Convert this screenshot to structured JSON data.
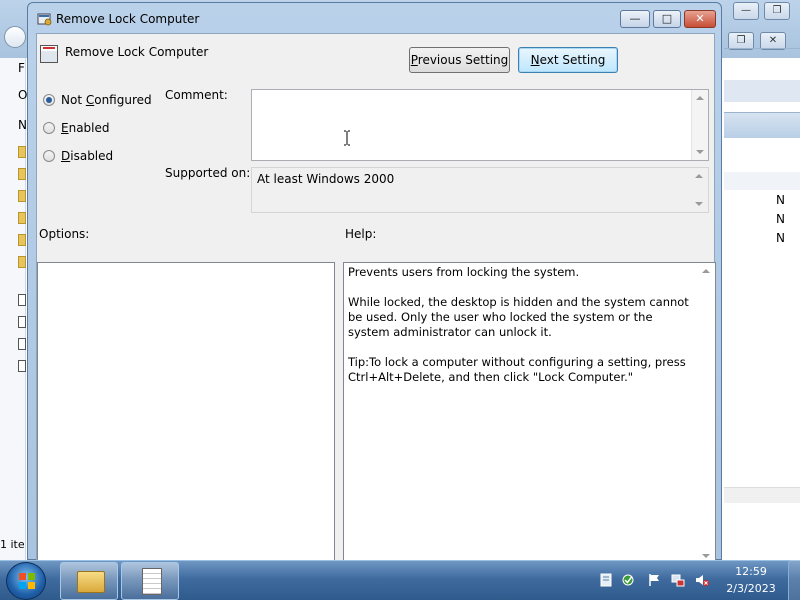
{
  "dialog": {
    "title": "Remove Lock Computer",
    "header_title": "Remove Lock Computer",
    "caption_buttons": {
      "minimize": "—",
      "maximize": "□",
      "close": "✕"
    }
  },
  "buttons": {
    "previous_prefix": "",
    "previous_underlined": "P",
    "previous_rest": "revious Setting",
    "next_prefix": "",
    "next_underlined": "N",
    "next_rest": "ext Setting"
  },
  "state": {
    "options": [
      {
        "label_prefix": "Not ",
        "underlined": "C",
        "label_rest": "onfigured",
        "checked": true
      },
      {
        "label_prefix": "",
        "underlined": "E",
        "label_rest": "nabled",
        "checked": false
      },
      {
        "label_prefix": "",
        "underlined": "D",
        "label_rest": "isabled",
        "checked": false
      }
    ]
  },
  "labels": {
    "comment": "Comment:",
    "supported_on": "Supported on:",
    "options": "Options:",
    "help": "Help:"
  },
  "comment_value": "",
  "supported_on_value": "At least Windows 2000",
  "help_text": "Prevents users from locking the system.\n\nWhile locked, the desktop is hidden and the system cannot be used. Only the user who locked the system or the system administrator can unlock it.\n\nTip:To lock a computer without configuring a setting, press Ctrl+Alt+Delete, and then click \"Lock Computer.\"",
  "background_window": {
    "letters_left": [
      "F",
      "O",
      "N"
    ],
    "status_text": "1 ite",
    "right_column_letters": [
      "N",
      "N",
      "N"
    ]
  },
  "taskbar": {
    "clock_time": "12:59",
    "clock_date": "2/3/2023",
    "tray_icons": [
      "action-center-icon",
      "security-icon",
      "flag-icon",
      "network-icon",
      "volume-muted-icon"
    ]
  },
  "colors": {
    "titlebar": "#bad1ea",
    "dialog_body": "#f0f0f0",
    "taskbar": "#3f6b9f",
    "next_button_highlight": "#bee6fd",
    "radio_dot": "#2a5d9e"
  }
}
